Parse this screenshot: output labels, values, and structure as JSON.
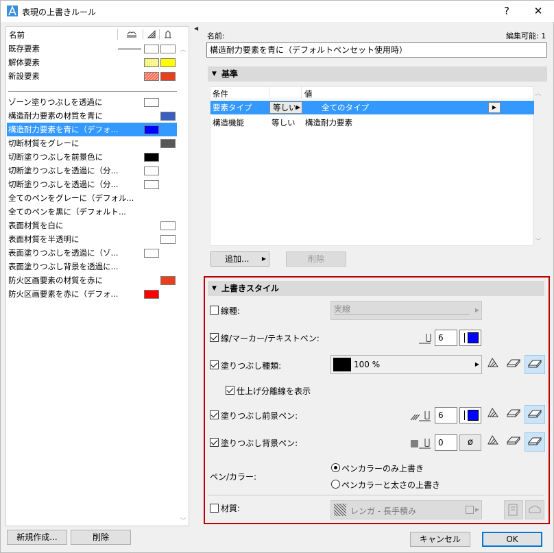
{
  "window": {
    "title": "表現の上書きルール",
    "help_label": "?",
    "close_label": "✕"
  },
  "left": {
    "header": {
      "name_label": "名前"
    },
    "top_items": [
      {
        "label": "既存要素",
        "line": true,
        "sw1": "#ffffff",
        "sw2": "#ffffff"
      },
      {
        "label": "解体要素",
        "sw1": "#ffff99",
        "sw1_pattern": "dots",
        "sw2": "#ffff00"
      },
      {
        "label": "新設要素",
        "sw1": "#ff7f6a",
        "sw1_pattern": "hatch",
        "sw2": "#e8401c"
      }
    ],
    "rules": [
      {
        "label": "ゾーン塗りつぶしを透過に",
        "sw": "#ffffff",
        "swpos": "mid"
      },
      {
        "label": "構造耐力要素の材質を青に",
        "sw": "#3a5fbf",
        "swpos": "right"
      },
      {
        "label": "構造耐力要素を青に（デフォ...",
        "sw": "#0000ff",
        "swpos": "mid",
        "selected": true
      },
      {
        "label": "切断材質をグレーに",
        "sw": "#585858",
        "swpos": "right"
      },
      {
        "label": "切断塗りつぶしを前景色に",
        "sw": "#000000",
        "swpos": "mid"
      },
      {
        "label": "切断塗りつぶしを透過に（分...",
        "sw": "#ffffff",
        "swpos": "mid"
      },
      {
        "label": "切断塗りつぶしを透過に（分...",
        "sw": "#ffffff",
        "swpos": "mid"
      },
      {
        "label": "全てのペンをグレーに（デフォル...",
        "sw": null
      },
      {
        "label": "全てのペンを黒に（デフォルト...",
        "sw": null
      },
      {
        "label": "表面材質を白に",
        "sw": "#ffffff",
        "swpos": "right"
      },
      {
        "label": "表面材質を半透明に",
        "sw": "#ffffff",
        "swpos": "right"
      },
      {
        "label": "表面塗りつぶしを透過に（ゾ...",
        "sw": "#ffffff",
        "swpos": "mid"
      },
      {
        "label": "表面塗りつぶし背景を透過に...",
        "sw": null
      },
      {
        "label": "防火区画要素の材質を赤に",
        "sw": "#e8401c",
        "swpos": "right"
      },
      {
        "label": "防火区画要素を赤に（デフォ...",
        "sw": "#ff0000",
        "swpos": "mid"
      }
    ],
    "new_button": "新規作成...",
    "delete_button": "削除"
  },
  "right": {
    "name_label": "名前:",
    "editable_label": "編集可能: 1",
    "name_value": "構造耐力要素を青に（デフォルトペンセット使用時）",
    "criteria": {
      "title": "基準",
      "col_condition": "条件",
      "col_value": "値",
      "rows": [
        {
          "condition": "要素タイプ",
          "op": "等しい",
          "value": "全てのタイプ",
          "selected": true
        },
        {
          "condition": "構造機能",
          "op": "等しい",
          "value": "構造耐力要素",
          "selected": false
        }
      ],
      "add_button": "追加...",
      "delete_button": "削除"
    },
    "style": {
      "title": "上書きスタイル",
      "line_type_label": "線種:",
      "line_type_value": "実線",
      "line_pen_label": "線/マーカー/テキストペン:",
      "line_pen_value": "6",
      "line_pen_color": "#0000ff",
      "fill_type_label": "塗りつぶし種類:",
      "fill_type_value": "100 %",
      "show_finish_label": "仕上げ分離線を表示",
      "fill_fg_label": "塗りつぶし前景ペン:",
      "fill_fg_value": "6",
      "fill_fg_color": "#0000ff",
      "fill_bg_label": "塗りつぶし背景ペン:",
      "fill_bg_value": "0",
      "fill_bg_symbol": "ø",
      "pen_color_label": "ペン/カラー:",
      "radio1_label": "ペンカラーのみ上書き",
      "radio2_label": "ペンカラーと太さの上書き",
      "material_label": "材質:",
      "material_value": "レンガ - 長手積み"
    },
    "cancel_button": "キャンセル",
    "ok_button": "OK"
  }
}
